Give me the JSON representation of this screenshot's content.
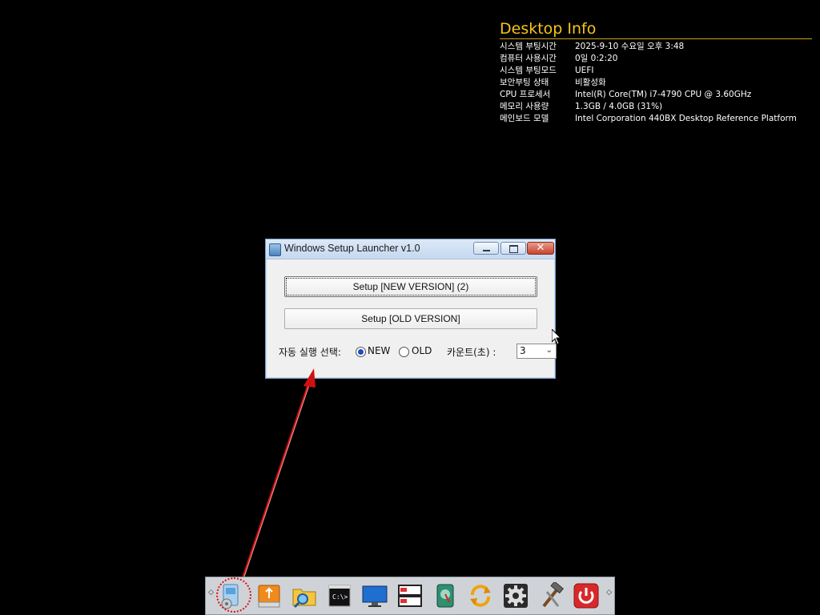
{
  "desktop_info": {
    "title": "Desktop Info",
    "rows": [
      {
        "key": "시스템 부팅시간",
        "value": "2025-9-10 수요일 오후 3:48"
      },
      {
        "key": "컴퓨터 사용시간",
        "value": "0일 0:2:20"
      },
      {
        "key": "시스템 부팅모드",
        "value": "UEFI"
      },
      {
        "key": "보안부팅 상태",
        "value": "비활성화"
      },
      {
        "key": "CPU 프로세서",
        "value": "Intel(R) Core(TM) i7-4790 CPU @ 3.60GHz"
      },
      {
        "key": "메모리 사용량",
        "value": "1.3GB / 4.0GB (31%)"
      },
      {
        "key": "메인보드 모델",
        "value": "Intel Corporation 440BX Desktop Reference Platform"
      }
    ]
  },
  "dialog": {
    "title": "Windows Setup Launcher v1.0",
    "btn_new": "Setup [NEW VERSION] (2)",
    "btn_old": "Setup [OLD VERSION]",
    "auto_label": "자동 실행 선택:",
    "radio_new": "NEW",
    "radio_old": "OLD",
    "selected_mode": "NEW",
    "count_label": "카운트(초) :",
    "count_value": "3"
  },
  "taskbar": {
    "nav_left": "◇",
    "nav_right": "◇",
    "items": [
      "setup-launcher-icon",
      "usb-drive-icon",
      "file-search-icon",
      "command-prompt-icon",
      "monitor-icon",
      "storage-cabinet-icon",
      "disk-tool-icon",
      "sync-icon",
      "settings-gear-icon",
      "tools-hammer-icon",
      "power-icon"
    ]
  },
  "colors": {
    "desktop_bg": "#000000",
    "info_title": "#f5c518",
    "annotation": "#d11111"
  }
}
